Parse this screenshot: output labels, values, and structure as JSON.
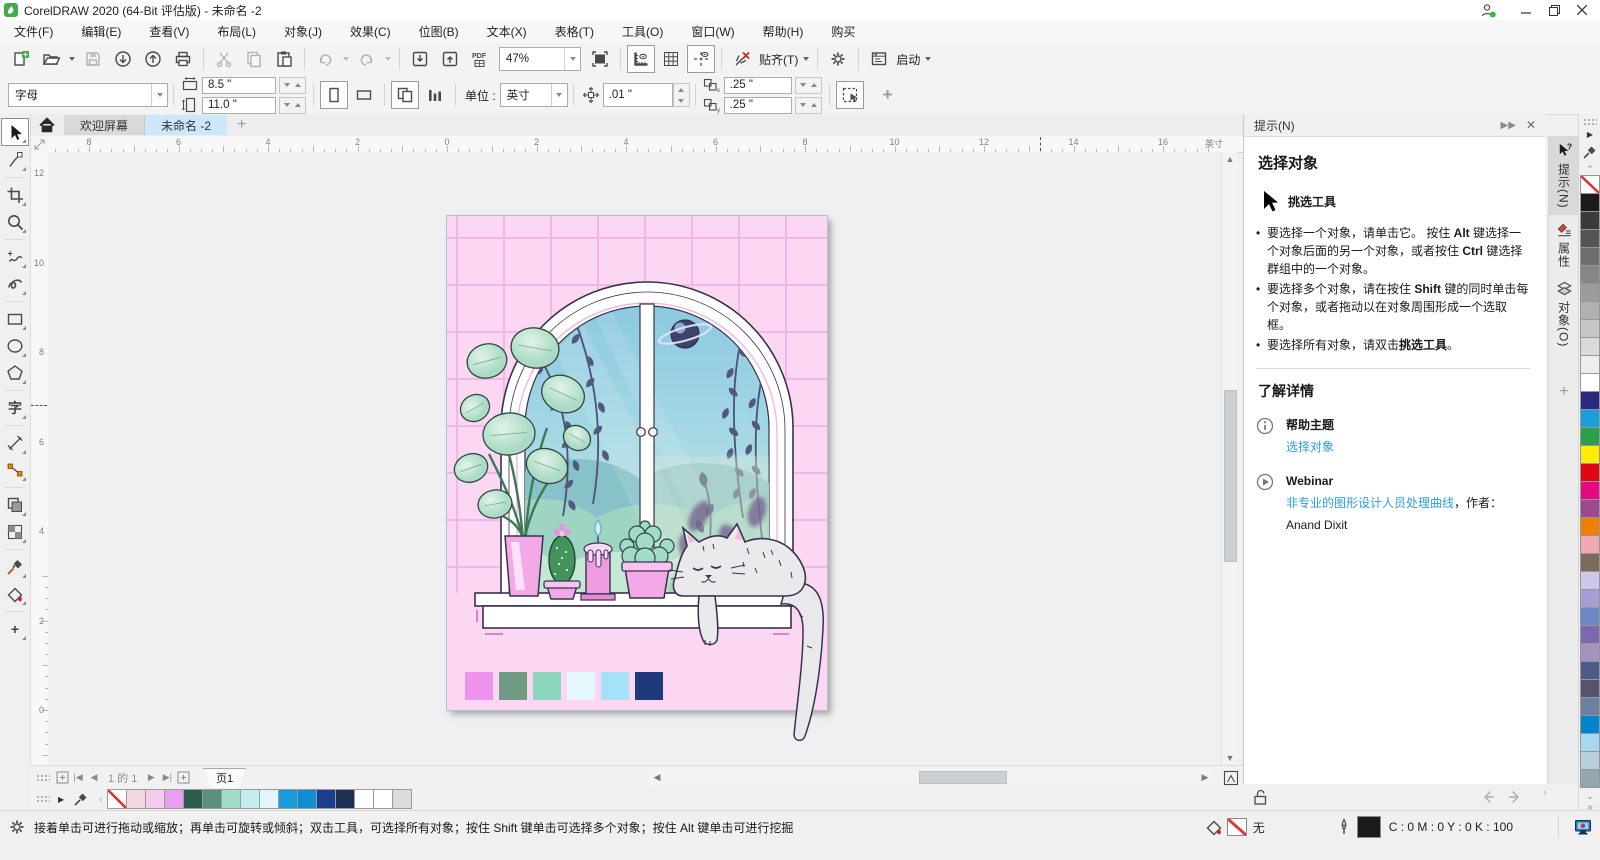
{
  "window": {
    "title": "CorelDRAW 2020 (64-Bit 评估版) - 未命名 -2",
    "logo_color": "#3fae49"
  },
  "menu": {
    "items": [
      "文件(F)",
      "编辑(E)",
      "查看(V)",
      "布局(L)",
      "对象(J)",
      "效果(C)",
      "位图(B)",
      "文本(X)",
      "表格(T)",
      "工具(O)",
      "窗口(W)",
      "帮助(H)",
      "购买"
    ]
  },
  "toolbar": {
    "zoom_value": "47%",
    "snap_label": "贴齐(T)",
    "launch_label": "启动",
    "items": [
      {
        "icon": "doc-new",
        "name": "new-document-button"
      },
      {
        "icon": "folder-open",
        "name": "open-button",
        "dropdown": true
      },
      {
        "icon": "save",
        "name": "save-button",
        "disabled": true
      },
      {
        "icon": "cloud-open",
        "name": "open-from-cloud-button"
      },
      {
        "icon": "cloud-save",
        "name": "save-to-cloud-button"
      },
      {
        "icon": "print",
        "name": "print-button"
      },
      {
        "sep": true
      },
      {
        "icon": "cut",
        "name": "cut-button",
        "disabled": true
      },
      {
        "icon": "copy",
        "name": "copy-button",
        "disabled": true
      },
      {
        "icon": "paste",
        "name": "paste-button"
      },
      {
        "sep": true
      },
      {
        "icon": "undo",
        "name": "undo-button",
        "disabled": true,
        "dropdown": true
      },
      {
        "icon": "redo",
        "name": "redo-button",
        "disabled": true,
        "dropdown": true
      },
      {
        "sep": true
      },
      {
        "icon": "import",
        "name": "import-button"
      },
      {
        "icon": "export",
        "name": "export-button"
      },
      {
        "icon": "pdf",
        "name": "share-pdf-button"
      },
      {
        "combo": "zoom_value",
        "name": "zoom-level-combobox"
      },
      {
        "icon": "fullscreen",
        "name": "fullscreen-preview-button"
      },
      {
        "sep": true
      },
      {
        "icon": "rulers",
        "name": "toggle-rulers-button",
        "pressed": true
      },
      {
        "icon": "grid",
        "name": "toggle-grid-button"
      },
      {
        "icon": "guidelines",
        "name": "toggle-guidelines-button",
        "pressed": true
      },
      {
        "sep": true
      },
      {
        "icon": "snap-off",
        "name": "snap-disable-button"
      },
      {
        "labelKey": "snap_label",
        "name": "snap-menu-button",
        "dropdown": true
      },
      {
        "sep": true
      },
      {
        "icon": "gear",
        "name": "options-button"
      },
      {
        "sep": true
      },
      {
        "icon": "launch",
        "name": "launch-button"
      },
      {
        "labelKey": "launch_label",
        "name": "launch-menu-button",
        "dropdown": true
      }
    ]
  },
  "property_bar": {
    "page_preset": "字母",
    "page_width": "8.5 \"",
    "page_height": "11.0 \"",
    "units_label": "单位 :",
    "units_value": "英寸",
    "nudge_distance": ".01 \"",
    "duplicate_x": ".25 \"",
    "duplicate_y": ".25 \""
  },
  "tabs": {
    "welcome": "欢迎屏幕",
    "document": "未命名 -2"
  },
  "ruler": {
    "h_labels": [
      "8",
      "6",
      "4",
      "2",
      "0",
      "2",
      "4",
      "6",
      "8",
      "10",
      "12",
      "14",
      "16"
    ],
    "v_labels": [
      "12",
      "10",
      "8",
      "6",
      "4",
      "2",
      "0"
    ],
    "unit": "英寸"
  },
  "toolbox": [
    {
      "icon": "pick",
      "name": "pick-tool",
      "selected": true
    },
    {
      "icon": "shape",
      "name": "shape-tool"
    },
    {
      "sep": true
    },
    {
      "icon": "crop",
      "name": "crop-tool"
    },
    {
      "icon": "zoomt",
      "name": "zoom-tool"
    },
    {
      "sep": true
    },
    {
      "icon": "freehand",
      "name": "freehand-tool"
    },
    {
      "icon": "artistic",
      "name": "artistic-media-tool"
    },
    {
      "sep": true
    },
    {
      "icon": "rectt",
      "name": "rectangle-tool"
    },
    {
      "icon": "ellipset",
      "name": "ellipse-tool"
    },
    {
      "icon": "polygont",
      "name": "polygon-tool"
    },
    {
      "sep": true
    },
    {
      "text": "字",
      "name": "text-tool"
    },
    {
      "sep": true
    },
    {
      "icon": "dimension",
      "name": "dimension-tool"
    },
    {
      "icon": "connector",
      "name": "connector-tool"
    },
    {
      "sep": true
    },
    {
      "icon": "shadow",
      "name": "drop-shadow-tool"
    },
    {
      "icon": "transparency",
      "name": "transparency-tool"
    },
    {
      "sep": true
    },
    {
      "icon": "eyedropper",
      "name": "color-eyedropper-tool"
    },
    {
      "icon": "filltool",
      "name": "interactive-fill-tool"
    },
    {
      "sep": true
    },
    {
      "text": "+",
      "name": "more-tools-button"
    }
  ],
  "docker": {
    "title": "提示(N)",
    "heading": "选择对象",
    "tool_label": "挑选工具",
    "bullets": [
      [
        {
          "t": "要选择一个对象，请单击它。 按住 "
        },
        {
          "t": "Alt",
          "b": true
        },
        {
          "t": " 键选择一个对象后面的另一个对象，或者按住 "
        },
        {
          "t": "Ctrl",
          "b": true
        },
        {
          "t": " 键选择群组中的一个对象。"
        }
      ],
      [
        {
          "t": "要选择多个对象，请在按住 "
        },
        {
          "t": "Shift",
          "b": true
        },
        {
          "t": " 键的同时单击每个对象，或者拖动以在对象周围形成一个选取框。"
        }
      ],
      [
        {
          "t": "要选择所有对象，请双击"
        },
        {
          "t": "挑选工具",
          "b": true
        },
        {
          "t": "。"
        }
      ]
    ],
    "learn_heading": "了解详情",
    "help_topics_label": "帮助主题",
    "help_link": "选择对象",
    "webinar_label": "Webinar",
    "webinar_link": "非专业的图形设计人员处理曲线",
    "webinar_suffix": "，作者：",
    "webinar_author": "Anand Dixit",
    "side_tabs": [
      {
        "label": "提示(N)",
        "icon": "cursor-help",
        "active": true,
        "name": "docker-tab-hints"
      },
      {
        "label": "属性",
        "icon": "prop-tab",
        "name": "docker-tab-properties"
      },
      {
        "label": "对象(O)",
        "icon": "objects-tab",
        "name": "docker-tab-objects"
      }
    ]
  },
  "palettes": {
    "right": [
      "none",
      "#1b1b19",
      "#3b3b3a",
      "#555554",
      "#6e6e6d",
      "#868686",
      "#9c9c9b",
      "#b1b1b1",
      "#c6c6c5",
      "#dadada",
      "#ededec",
      "#ffffff",
      "#2b2a81",
      "#1a9fdc",
      "#2a9e49",
      "#ffec00",
      "#dd0613",
      "#e5097f",
      "#9c4a8f",
      "#ee7f03",
      "#f0a9ae",
      "#7d6a5c",
      "#cfc7e7",
      "#a79fd4",
      "#6d86c5",
      "#7a68b0",
      "#a294bf",
      "#4c5c88",
      "#57536a",
      "#6d80a4",
      "#0084cc",
      "#a8d8f1",
      "#bacfdb",
      "#93a7b0"
    ],
    "document": [
      "none",
      "#f2d7e1",
      "#f8cbee",
      "#e89ef1",
      "#2e5c52",
      "#58927b",
      "#a0dcc6",
      "#c3ecf1",
      "#e2f5fa",
      "#189cd9",
      "#0f8fd0",
      "#1b3d8d",
      "#1f3050",
      "#ffffff",
      "#ffffff",
      "#dcdcdc"
    ]
  },
  "artwork": {
    "swatches": [
      "#ec94ee",
      "#6f9c82",
      "#8bd6bd",
      "#e6f7fc",
      "#a5e2f8",
      "#1e3a7d"
    ]
  },
  "page_nav": {
    "counter": "1 的 1",
    "page_tab": "页1"
  },
  "status": {
    "hint": "接着单击可进行拖动或缩放；再单击可旋转或倾斜；双击工具，可选择所有对象；按住 Shift 键单击可选择多个对象；按住 Alt 键单击可进行挖掘",
    "fill_label": "无",
    "outline_cmyk": "C : 0 M : 0 Y : 0 K : 100"
  }
}
